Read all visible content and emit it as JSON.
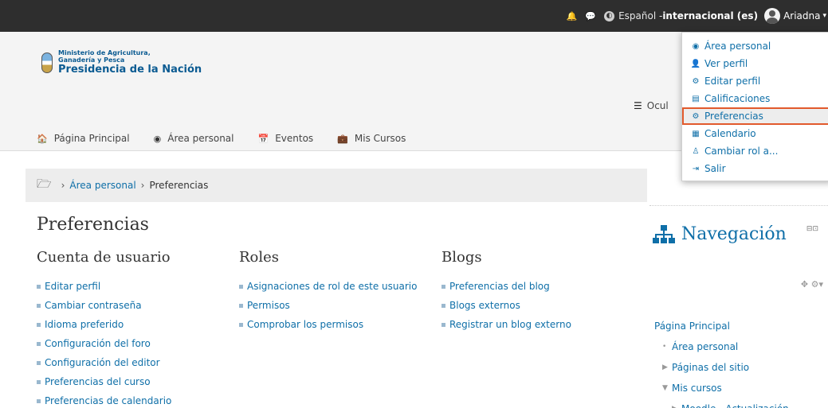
{
  "topbar": {
    "language_prefix": "Español - ",
    "language_bold": "internacional (es)",
    "user_name": "Ariadna"
  },
  "logo": {
    "line1": "Ministerio de Agricultura,",
    "line2": "Ganadería y Pesca",
    "line3": "Presidencia de la Nación"
  },
  "nav": {
    "items": [
      "Página Principal",
      "Área personal",
      "Eventos",
      "Mis Cursos"
    ],
    "hide_label": "Ocul"
  },
  "breadcrumb": {
    "items": [
      "Área personal",
      "Preferencias"
    ]
  },
  "page": {
    "title": "Preferencias"
  },
  "columns": [
    {
      "heading": "Cuenta de usuario",
      "links": [
        "Editar perfil",
        "Cambiar contraseña",
        "Idioma preferido",
        "Configuración del foro",
        "Configuración del editor",
        "Preferencias del curso",
        "Preferencias de calendario"
      ]
    },
    {
      "heading": "Roles",
      "links": [
        "Asignaciones de rol de este usuario",
        "Permisos",
        "Comprobar los permisos"
      ]
    },
    {
      "heading": "Blogs",
      "links": [
        "Preferencias del blog",
        "Blogs externos",
        "Registrar un blog externo"
      ]
    }
  ],
  "navigation_block": {
    "title": "Navegación",
    "items": [
      "Página Principal",
      "Área personal",
      "Páginas del sitio",
      "Mis cursos",
      "Moodle - Actualización"
    ]
  },
  "user_menu": {
    "items": [
      "Área personal",
      "Ver perfil",
      "Editar perfil",
      "Calificaciones",
      "Preferencias",
      "Calendario",
      "Cambiar rol a...",
      "Salir"
    ],
    "active": "Preferencias"
  },
  "colors": {
    "topbar": "#2e2e2e",
    "link": "#0f6fa8",
    "highlight_outline": "#e25a2c"
  }
}
